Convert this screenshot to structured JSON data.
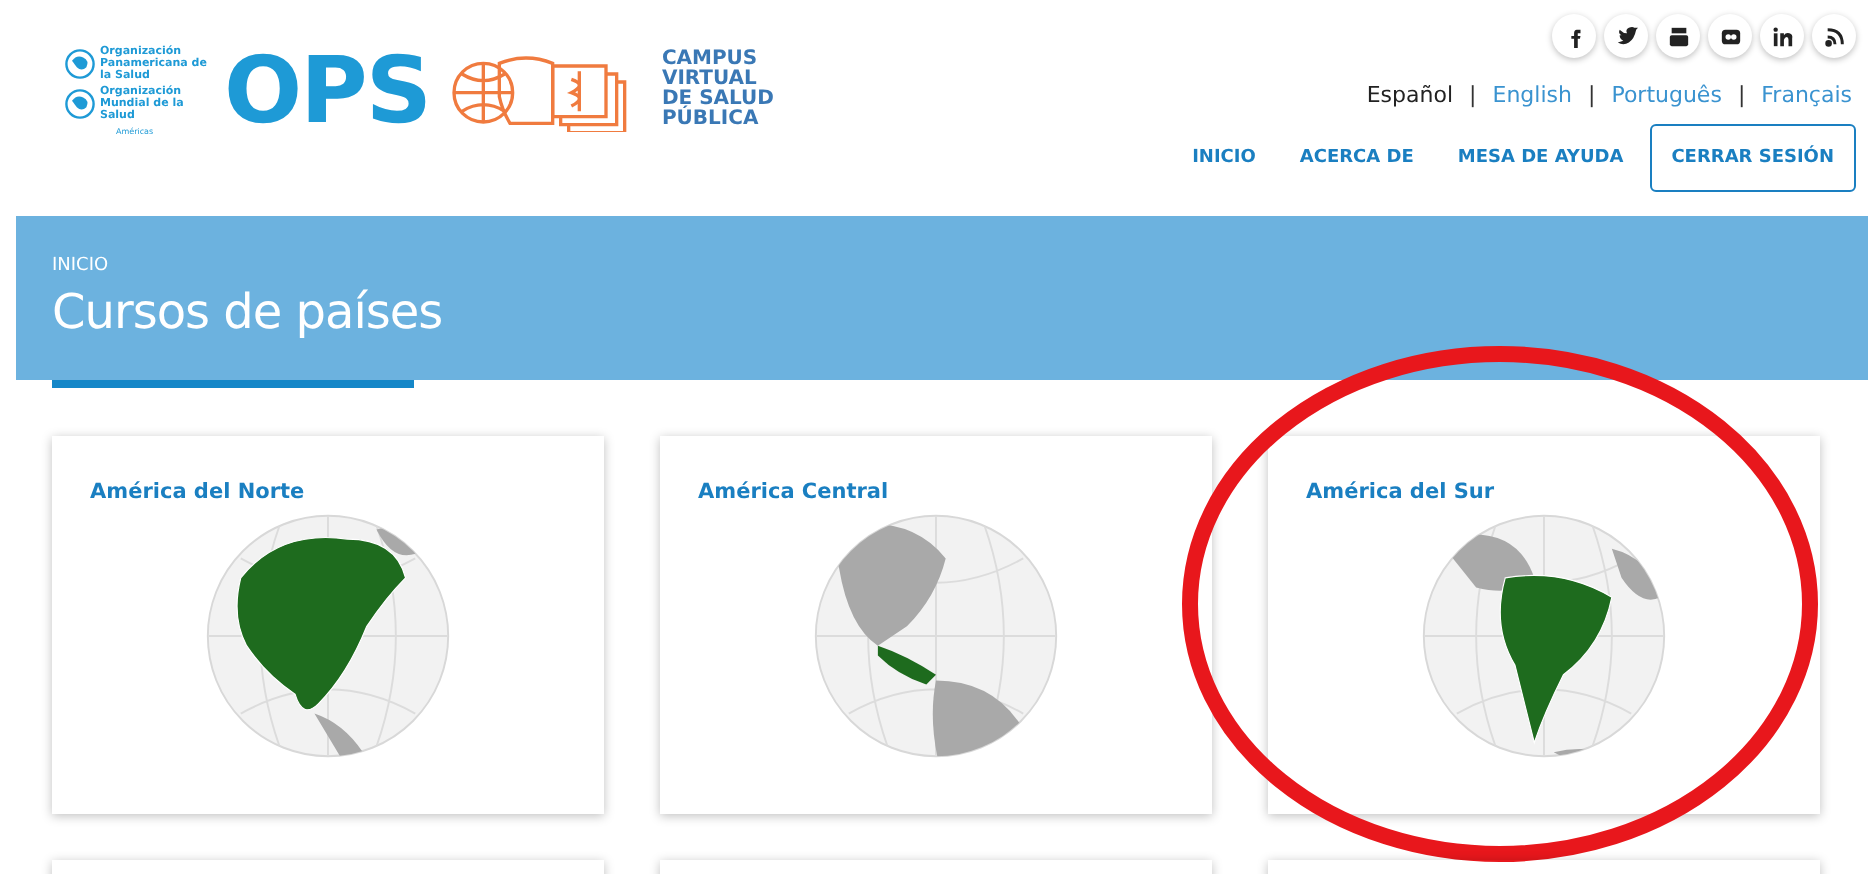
{
  "logo": {
    "org_lines": [
      "Organización Panamericana de la Salud",
      "Organización Mundial de la Salud"
    ],
    "region": "Américas",
    "acronym": "OPS",
    "campus_lines": [
      "CAMPUS",
      "VIRTUAL",
      "DE SALUD",
      "PÚBLICA"
    ]
  },
  "social": [
    {
      "kind": "facebook"
    },
    {
      "kind": "twitter"
    },
    {
      "kind": "youtube"
    },
    {
      "kind": "flickr"
    },
    {
      "kind": "linkedin"
    },
    {
      "kind": "rss"
    }
  ],
  "languages": [
    {
      "label": "Español",
      "selected": true
    },
    {
      "separator": "|",
      "label": "English",
      "selected": false
    },
    {
      "separator": "|",
      "label": "Português",
      "selected": false
    },
    {
      "separator": "|",
      "label": "Français",
      "selected": false
    }
  ],
  "nav": [
    {
      "label": "INICIO",
      "kind": "link"
    },
    {
      "label": "ACERCA DE",
      "kind": "link"
    },
    {
      "label": "MESA DE AYUDA",
      "kind": "link"
    },
    {
      "label": "CERRAR SESIÓN",
      "kind": "outlined"
    }
  ],
  "banner": {
    "breadcrumb": "INICIO",
    "title": "Cursos de países"
  },
  "cards": [
    {
      "title": "América del Norte",
      "kind": "north",
      "highlighted": false
    },
    {
      "title": "América Central",
      "kind": "central",
      "highlighted": false
    },
    {
      "title": "América del Sur",
      "kind": "south",
      "highlighted": true
    }
  ]
}
